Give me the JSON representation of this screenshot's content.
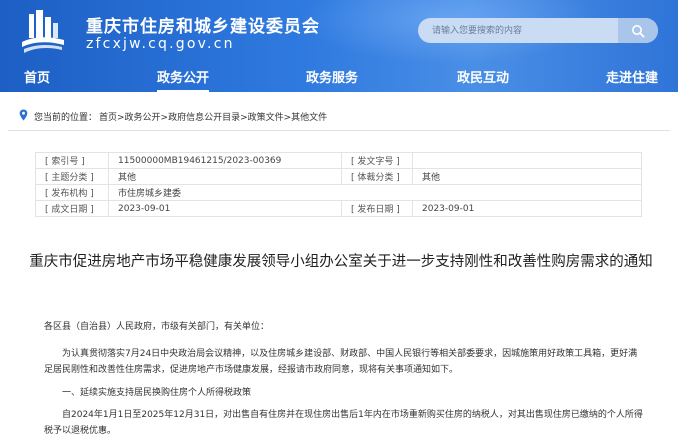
{
  "header": {
    "title": "重庆市住房和城乡建设委员会",
    "domain": "zfcxjw.cq.gov.cn",
    "search_placeholder": "请输入您要搜索的内容"
  },
  "nav": {
    "items": [
      {
        "label": "首页"
      },
      {
        "label": "政务公开",
        "active": true
      },
      {
        "label": "政务服务"
      },
      {
        "label": "政民互动"
      },
      {
        "label": "走进住建"
      }
    ]
  },
  "breadcrumb": {
    "label": "您当前的位置：",
    "path": "首页>政务公开>政府信息公开目录>政策文件>其他文件"
  },
  "meta": {
    "index_label": "[ 索引号 ]",
    "index_value": "11500000MB19461215/2023-00369",
    "docno_label": "[ 发文字号 ]",
    "docno_value": "",
    "topic_label": "[ 主题分类 ]",
    "topic_value": "其他",
    "genre_label": "[ 体裁分类 ]",
    "genre_value": "其他",
    "issuer_label": "[ 发布机构 ]",
    "issuer_value": "市住房城乡建委",
    "created_label": "[ 成文日期 ]",
    "created_value": "2023-09-01",
    "published_label": "[ 发布日期 ]",
    "published_value": "2023-09-01"
  },
  "document": {
    "title": "重庆市促进房地产市场平稳健康发展领导小组办公室关于进一步支持刚性和改善性购房需求的通知",
    "greeting": "各区县（自治县）人民政府，市级有关部门，有关单位：",
    "para1": "为认真贯彻落实7月24日中央政治局会议精神，以及住房城乡建设部、财政部、中国人民银行等相关部委要求，因城施策用好政策工具箱，更好满足居民刚性和改善性住房需求，促进房地产市场健康发展，经报请市政府同意，现将有关事项通知如下。",
    "para2": "一、延续实施支持居民换购住房个人所得税政策",
    "para3": "自2024年1月1日至2025年12月31日，对出售自有住房并在现住房出售后1年内在市场重新购买住房的纳税人，对其出售现住房已缴纳的个人所得税予以退税优惠。"
  },
  "colors": {
    "header_blue": "#2f7ae0",
    "search_bg": "#c9dcf3"
  }
}
